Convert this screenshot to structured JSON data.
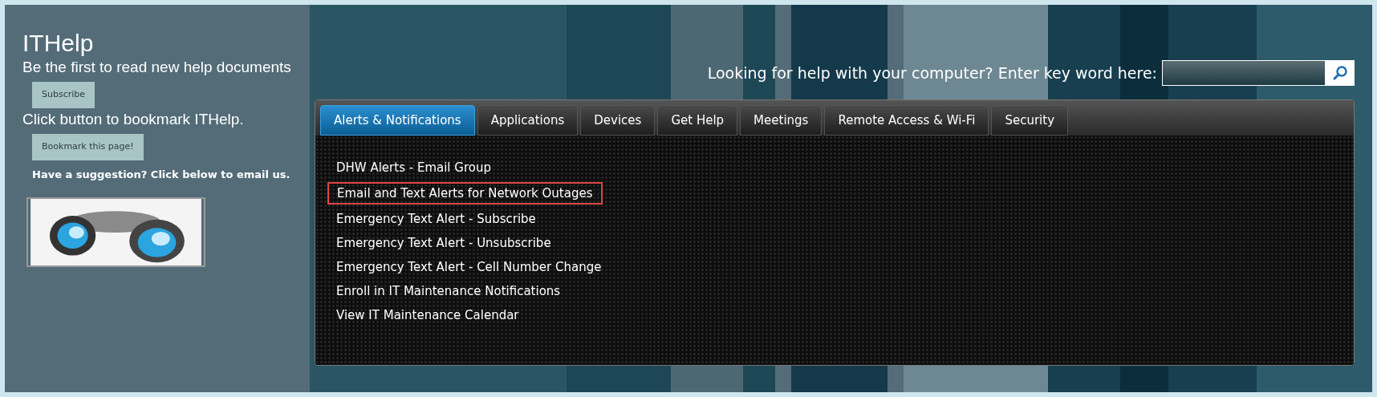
{
  "site": {
    "title": "ITHelp"
  },
  "sidebar": {
    "subscribe_text": "Be the first to read new help documents",
    "subscribe_button": "Subscribe",
    "bookmark_text": "Click button to bookmark ITHelp.",
    "bookmark_button": "Bookmark this page!",
    "suggestion_text": "Have a suggestion? Click below to email us."
  },
  "search": {
    "label": "Looking for help with your computer? Enter key word here:"
  },
  "tabs": [
    {
      "label": "Alerts & Notifications",
      "selected": true
    },
    {
      "label": "Applications",
      "selected": false
    },
    {
      "label": "Devices",
      "selected": false
    },
    {
      "label": "Get Help",
      "selected": false
    },
    {
      "label": "Meetings",
      "selected": false
    },
    {
      "label": "Remote Access & Wi-Fi",
      "selected": false
    },
    {
      "label": "Security",
      "selected": false
    }
  ],
  "links": [
    {
      "label": "DHW Alerts - Email Group",
      "highlighted": false
    },
    {
      "label": "Email and Text Alerts for Network Outages",
      "highlighted": true
    },
    {
      "label": "Emergency Text Alert - Subscribe",
      "highlighted": false
    },
    {
      "label": "Emergency Text Alert - Unsubscribe",
      "highlighted": false
    },
    {
      "label": "Emergency Text Alert - Cell Number Change",
      "highlighted": false
    },
    {
      "label": "Enroll in IT Maintenance Notifications",
      "highlighted": false
    },
    {
      "label": "View IT Maintenance Calendar",
      "highlighted": false
    }
  ]
}
